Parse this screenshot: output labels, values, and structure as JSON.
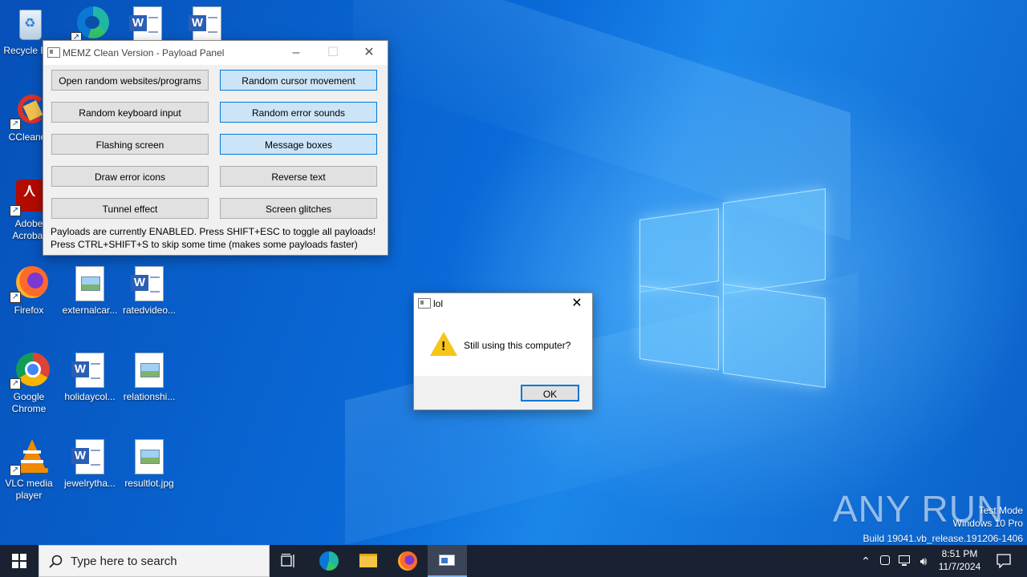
{
  "desktop": {
    "icons": [
      {
        "label": "Recycle Bin",
        "type": "recycle"
      },
      {
        "label": "",
        "type": "edge"
      },
      {
        "label": "",
        "type": "word"
      },
      {
        "label": "",
        "type": "word"
      },
      {
        "label": "CCleaner",
        "type": "ccleaner"
      },
      {
        "label": "Adobe Acrobat",
        "type": "acrobat"
      },
      {
        "label": "Firefox",
        "type": "firefox"
      },
      {
        "label": "externalcar...",
        "type": "image"
      },
      {
        "label": "ratedvideo...",
        "type": "word"
      },
      {
        "label": "Google Chrome",
        "type": "chrome"
      },
      {
        "label": "holidaycol...",
        "type": "word"
      },
      {
        "label": "relationshi...",
        "type": "image"
      },
      {
        "label": "VLC media player",
        "type": "vlc"
      },
      {
        "label": "jewelrytha...",
        "type": "word"
      },
      {
        "label": "resultlot.jpg",
        "type": "image"
      }
    ],
    "watermark": {
      "brand": "ANY RUN",
      "line1": "Test Mode",
      "line2": "Windows 10 Pro",
      "line3": "Build 19041.vb_release.191206-1406"
    }
  },
  "payload_panel": {
    "title": "MEMZ Clean Version - Payload Panel",
    "buttons": [
      {
        "label": "Open random websites/programs",
        "active": false
      },
      {
        "label": "Random cursor movement",
        "active": true
      },
      {
        "label": "Random keyboard input",
        "active": false
      },
      {
        "label": "Random error sounds",
        "active": true
      },
      {
        "label": "Flashing screen",
        "active": false
      },
      {
        "label": "Message boxes",
        "active": true
      },
      {
        "label": "Draw error icons",
        "active": false
      },
      {
        "label": "Reverse text",
        "active": false
      },
      {
        "label": "Tunnel effect",
        "active": false
      },
      {
        "label": "Screen glitches",
        "active": false
      }
    ],
    "status_line1": "Payloads are currently ENABLED. Press SHIFT+ESC to toggle all payloads!",
    "status_line2": "Press CTRL+SHIFT+S to skip some time (makes some payloads faster)"
  },
  "message_box": {
    "title": "lol",
    "message": "Still using this computer?",
    "ok_label": "OK",
    "icon": "warning-icon"
  },
  "taskbar": {
    "search_placeholder": "Type here to search",
    "time": "8:51 PM",
    "date": "11/7/2024"
  },
  "colors": {
    "accent": "#0078d7",
    "active_button": "#cce4f7",
    "taskbar": "#1a2231"
  }
}
